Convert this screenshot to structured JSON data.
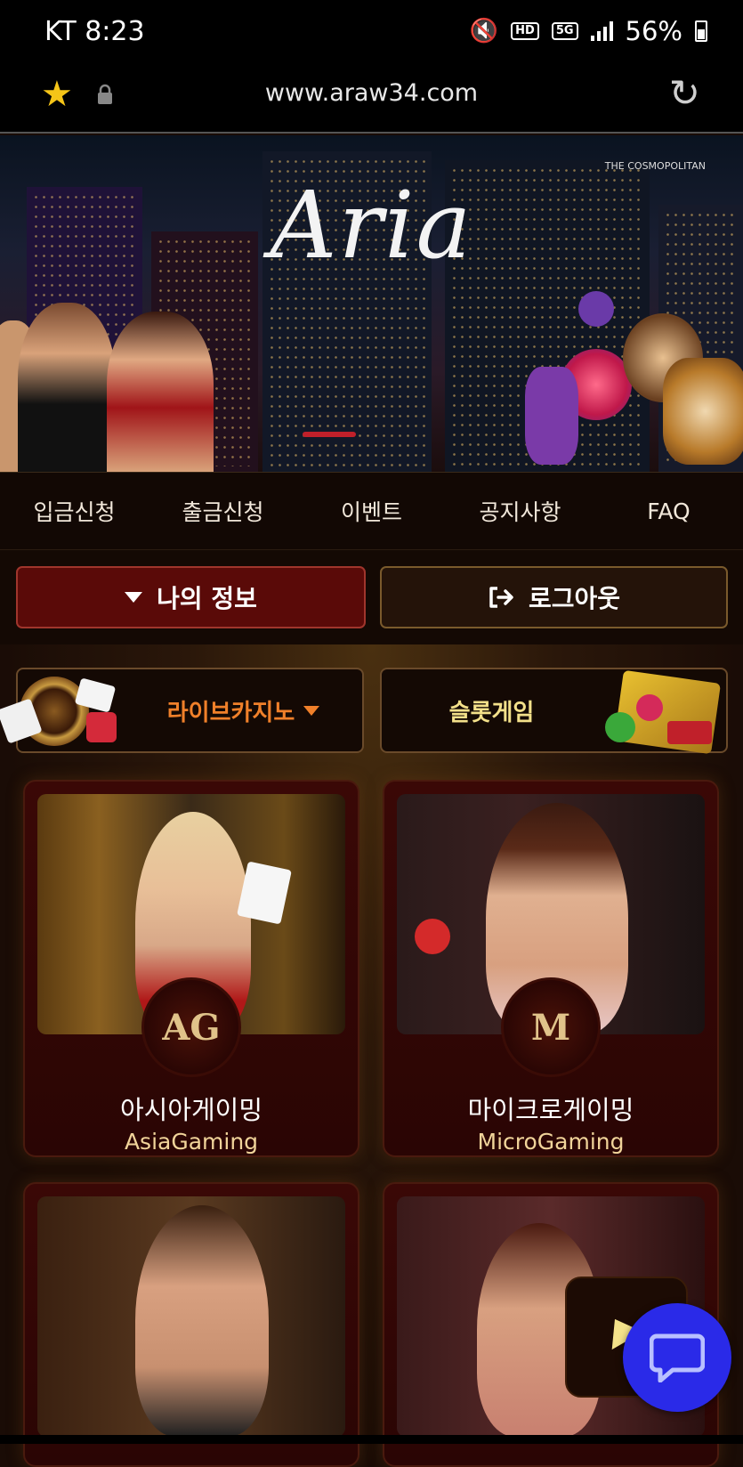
{
  "status_bar": {
    "carrier_time": "KT 8:23",
    "hd_badge": "HD",
    "network_badge": "5G",
    "battery_text": "56%"
  },
  "browser": {
    "url": "www.araw34.com"
  },
  "banner": {
    "logo": "Aria",
    "building_sign": "THE COSMOPOLITAN"
  },
  "nav": {
    "items": [
      "입금신청",
      "출금신청",
      "이벤트",
      "공지사항",
      "FAQ"
    ]
  },
  "account": {
    "my_info_label": "나의 정보",
    "logout_label": "로그아웃"
  },
  "categories": {
    "live_casino": "라이브카지노",
    "slot_game": "슬롯게임"
  },
  "games": [
    {
      "name_ko": "아시아게이밍",
      "name_en": "AsiaGaming",
      "logo_text": "AG"
    },
    {
      "name_ko": "마이크로게이밍",
      "name_en": "MicroGaming",
      "logo_text": "M"
    }
  ],
  "colors": {
    "accent_red": "#5a0a08",
    "live_casino_orange": "#f0802a",
    "gold": "#f1d49a",
    "chat_blue": "#2a2ae8"
  }
}
